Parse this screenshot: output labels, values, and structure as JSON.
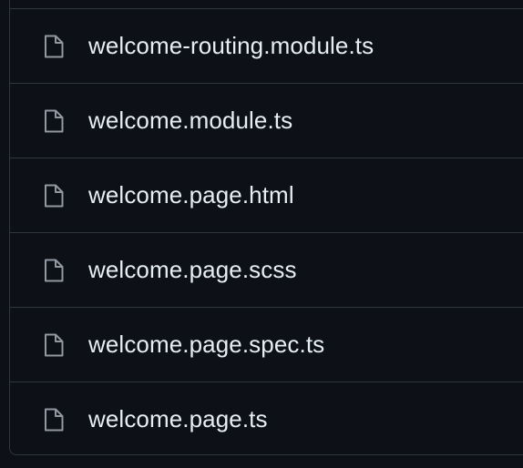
{
  "files": [
    {
      "name": "welcome-routing.module.ts",
      "icon": "file-icon"
    },
    {
      "name": "welcome.module.ts",
      "icon": "file-icon"
    },
    {
      "name": "welcome.page.html",
      "icon": "file-icon"
    },
    {
      "name": "welcome.page.scss",
      "icon": "file-icon"
    },
    {
      "name": "welcome.page.spec.ts",
      "icon": "file-icon"
    },
    {
      "name": "welcome.page.ts",
      "icon": "file-icon"
    }
  ],
  "colors": {
    "background": "#0d1117",
    "border": "#30363d",
    "text": "#e6edf3",
    "icon": "#9198a1"
  }
}
